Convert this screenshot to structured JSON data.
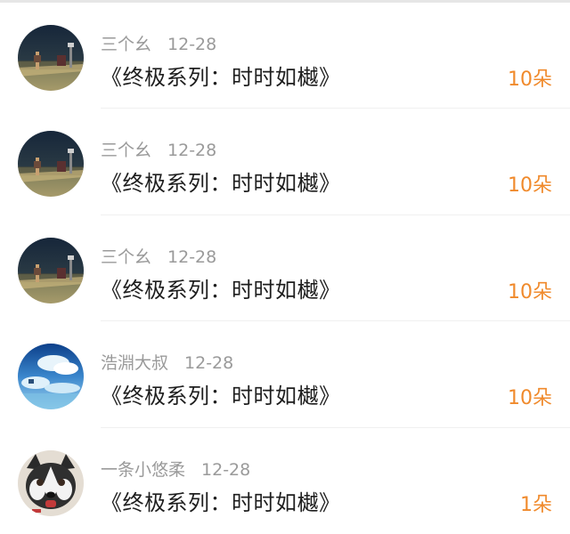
{
  "gifts": [
    {
      "user": "三个幺",
      "date": "12-28",
      "title": "《终极系列：时时如樾》",
      "amount": "10朵",
      "avatar": "road-scene-avatar"
    },
    {
      "user": "三个幺",
      "date": "12-28",
      "title": "《终极系列：时时如樾》",
      "amount": "10朵",
      "avatar": "road-scene-avatar"
    },
    {
      "user": "三个幺",
      "date": "12-28",
      "title": "《终极系列：时时如樾》",
      "amount": "10朵",
      "avatar": "road-scene-avatar"
    },
    {
      "user": "浩淵大叔",
      "date": "12-28",
      "title": "《终极系列：时时如樾》",
      "amount": "10朵",
      "avatar": "sky-clouds-avatar"
    },
    {
      "user": "一条小悠柔",
      "date": "12-28",
      "title": "《终极系列：时时如樾》",
      "amount": "1朵",
      "avatar": "husky-dog-avatar"
    }
  ],
  "colors": {
    "amount": "#f08a2c",
    "title": "#1e1e1e",
    "meta": "#9a9a9a"
  }
}
